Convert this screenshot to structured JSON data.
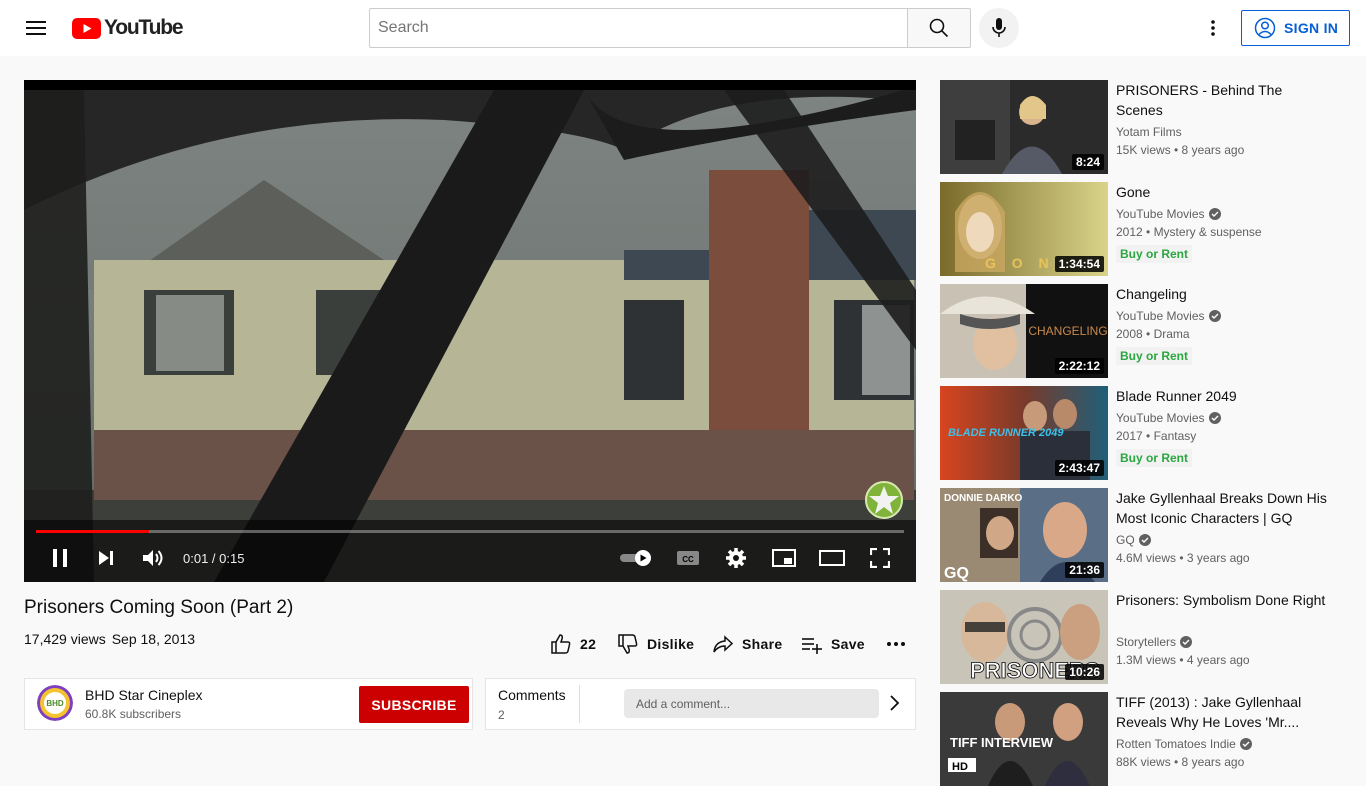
{
  "masthead": {
    "logo_text": "YouTube",
    "search_placeholder": "Search",
    "signin_label": "SIGN IN"
  },
  "player": {
    "time": "0:01 / 0:15",
    "progress_fraction": 0.13
  },
  "video": {
    "title": "Prisoners Coming Soon (Part 2)",
    "views": "17,429 views",
    "date": "Sep 18, 2013",
    "likes": "22",
    "dislike_label": "Dislike",
    "share_label": "Share",
    "save_label": "Save"
  },
  "channel": {
    "name": "BHD Star Cineplex",
    "subscribers": "60.8K subscribers",
    "subscribe_label": "SUBSCRIBE",
    "avatar_text": "BHD"
  },
  "comments": {
    "title": "Comments",
    "count": "2",
    "placeholder": "Add a comment..."
  },
  "recommendations": [
    {
      "title": "PRISONERS - Behind The Scenes",
      "channel": "Yotam Films",
      "verified": false,
      "meta": "15K views • 8 years ago",
      "duration": "8:24",
      "buy": ""
    },
    {
      "title": "Gone",
      "channel": "YouTube Movies",
      "verified": true,
      "meta": "2012 • Mystery & suspense",
      "duration": "1:34:54",
      "buy": "Buy or Rent",
      "thumb_text": "G O N"
    },
    {
      "title": "Changeling",
      "channel": "YouTube Movies",
      "verified": true,
      "meta": "2008 • Drama",
      "duration": "2:22:12",
      "buy": "Buy or Rent",
      "thumb_text": "CHANGELING"
    },
    {
      "title": "Blade Runner 2049",
      "channel": "YouTube Movies",
      "verified": true,
      "meta": "2017 • Fantasy",
      "duration": "2:43:47",
      "buy": "Buy or Rent",
      "thumb_text": "BLADE RUNNER 2049"
    },
    {
      "title": "Jake Gyllenhaal Breaks Down His Most Iconic Characters | GQ",
      "channel": "GQ",
      "verified": true,
      "meta": "4.6M views • 3 years ago",
      "duration": "21:36",
      "buy": "",
      "thumb_text": "DONNIE DARKO",
      "thumb_text2": "GQ"
    },
    {
      "title": "Prisoners: Symbolism Done Right",
      "channel": "Storytellers",
      "verified": true,
      "meta": "1.3M views • 4 years ago",
      "duration": "10:26",
      "buy": "",
      "thumb_text": "PRISONERS"
    },
    {
      "title": "TIFF (2013) : Jake Gyllenhaal Reveals Why He Loves 'Mr....",
      "channel": "Rotten Tomatoes Indie",
      "verified": true,
      "meta": "88K views • 8 years ago",
      "duration": "",
      "buy": "",
      "thumb_text": "TIFF INTERVIEW",
      "thumb_text2": "HD"
    }
  ],
  "colors": {
    "accent_red": "#ff0000",
    "subscribe_red": "#cc0000",
    "link_blue": "#065fd4",
    "buy_green": "#2ba640"
  }
}
